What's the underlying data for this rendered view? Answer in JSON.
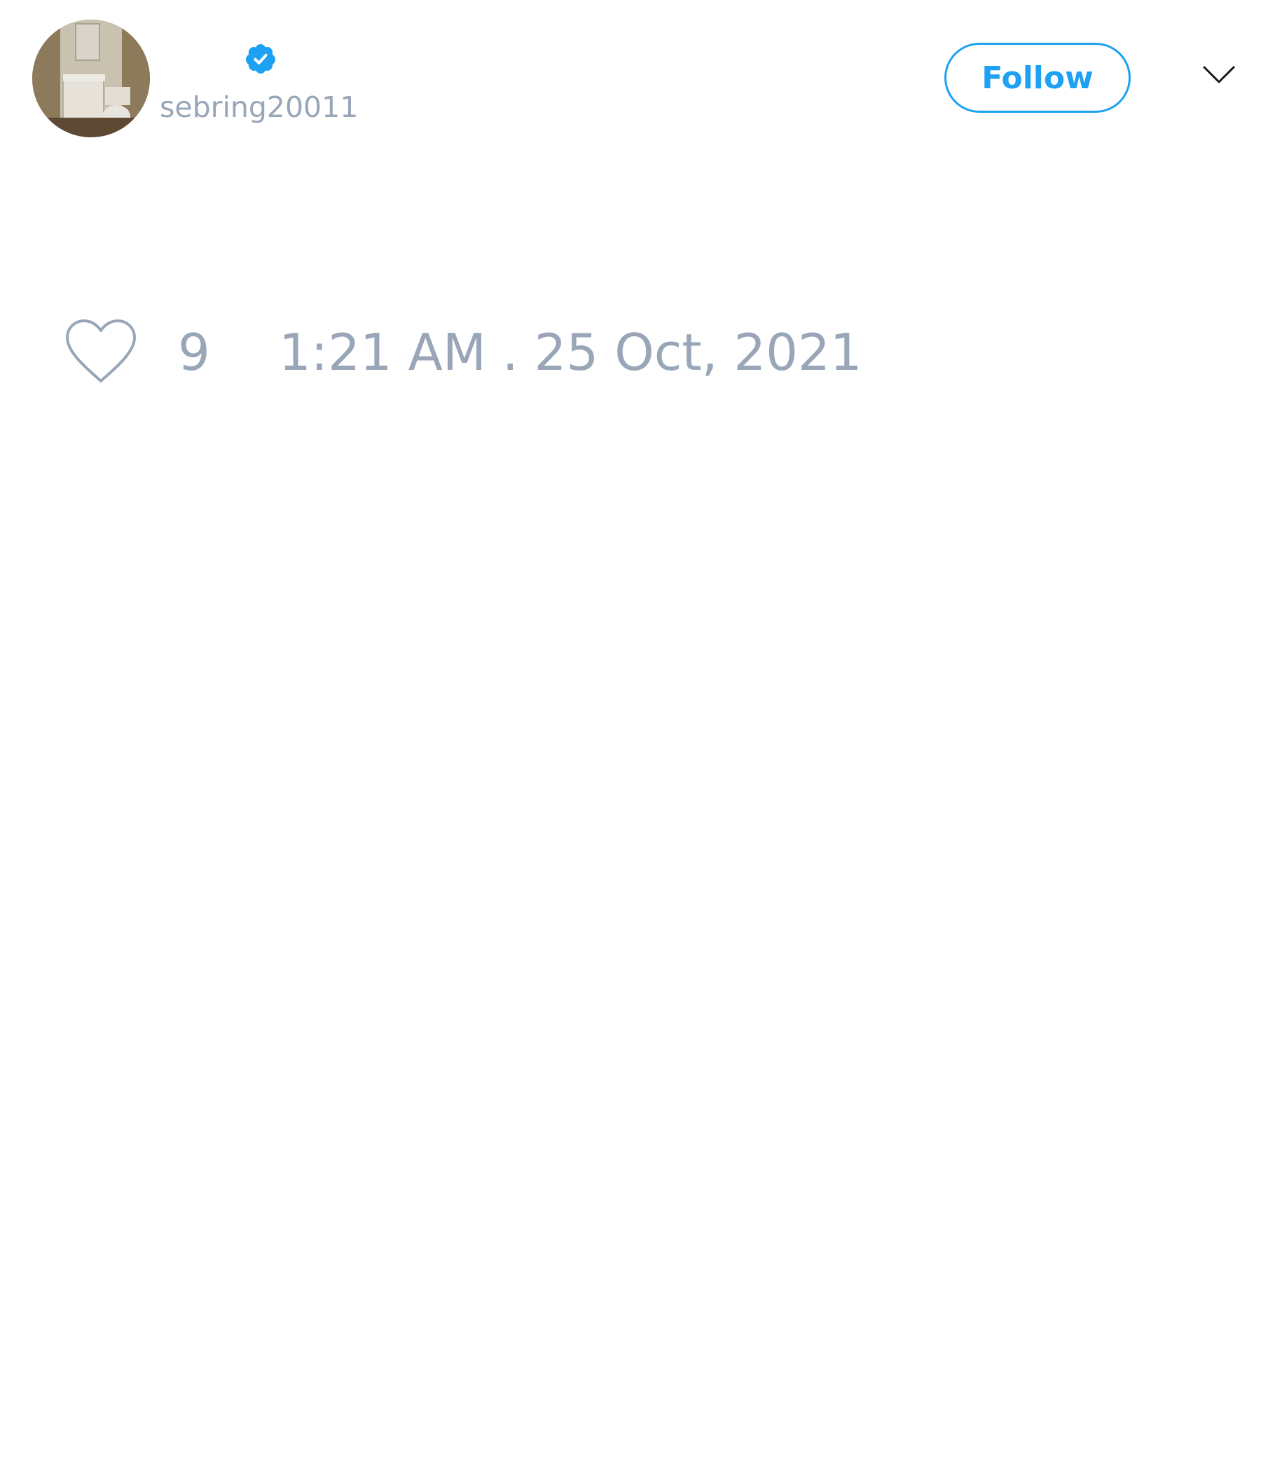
{
  "tweet": {
    "author": {
      "display_name": "",
      "username": "sebring20011",
      "verified": true,
      "avatar_icon": "avatar-photo-bathroom"
    },
    "follow_label": "Follow",
    "menu_icon": "chevron-down-icon",
    "like_icon": "heart-icon",
    "like_count": "9",
    "timestamp": "1:21 AM . 25 Oct, 2021"
  },
  "colors": {
    "accent": "#1da1f2",
    "muted_text": "#98a6b8",
    "background": "#ffffff"
  }
}
